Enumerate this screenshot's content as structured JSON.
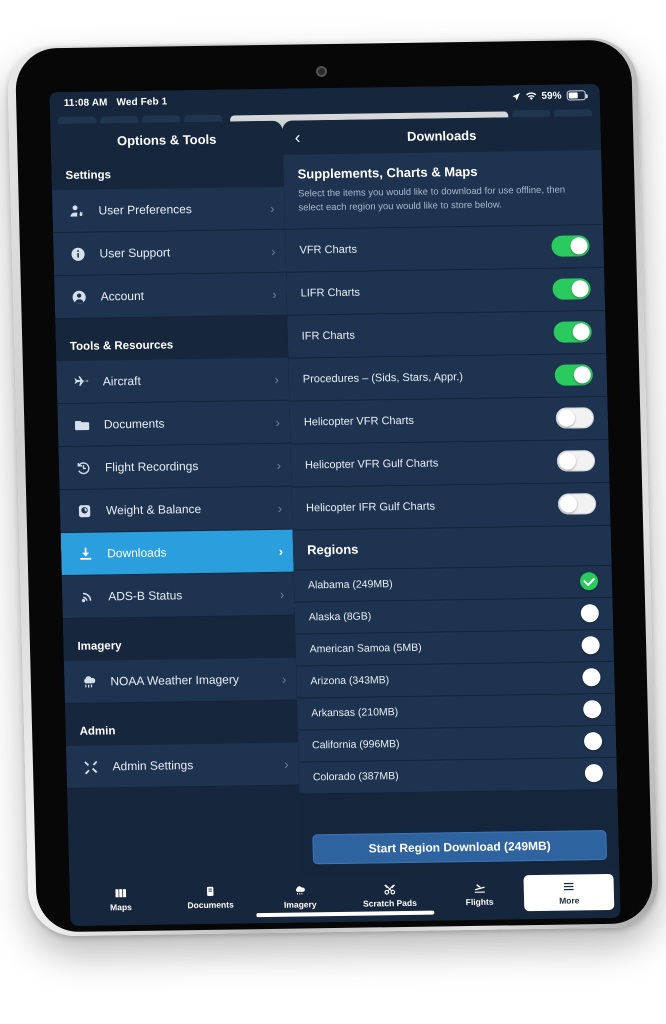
{
  "status_bar": {
    "time": "11:08 AM",
    "date": "Wed Feb 1",
    "battery_percent": "59%",
    "location_icon": "location-arrow-icon",
    "wifi_icon": "wifi-icon",
    "battery_icon": "battery-icon"
  },
  "sidebar": {
    "title": "Options & Tools",
    "groups": [
      {
        "header": "Settings",
        "items": [
          {
            "label": "User Preferences",
            "icon": "user-gear-icon",
            "active": false
          },
          {
            "label": "User Support",
            "icon": "info-circle-icon",
            "active": false
          },
          {
            "label": "Account",
            "icon": "person-circle-icon",
            "active": false
          }
        ]
      },
      {
        "header": "Tools & Resources",
        "items": [
          {
            "label": "Aircraft",
            "icon": "airplane-icon",
            "active": false
          },
          {
            "label": "Documents",
            "icon": "folder-icon",
            "active": false
          },
          {
            "label": "Flight Recordings",
            "icon": "clock-rewind-icon",
            "active": false
          },
          {
            "label": "Weight & Balance",
            "icon": "scale-icon",
            "active": false
          },
          {
            "label": "Downloads",
            "icon": "download-icon",
            "active": true
          },
          {
            "label": "ADS-B Status",
            "icon": "broadcast-icon",
            "active": false
          }
        ]
      },
      {
        "header": "Imagery",
        "items": [
          {
            "label": "NOAA Weather Imagery",
            "icon": "cloud-rain-icon",
            "active": false
          }
        ]
      },
      {
        "header": "Admin",
        "items": [
          {
            "label": "Admin Settings",
            "icon": "tools-icon",
            "active": false
          }
        ]
      }
    ]
  },
  "detail": {
    "title": "Downloads",
    "back_icon": "chevron-left-icon",
    "section": {
      "title": "Supplements, Charts & Maps",
      "description": "Select the items you would like to download for use offline, then select each region you would like to store below."
    },
    "chart_toggles": [
      {
        "label": "VFR Charts",
        "on": true
      },
      {
        "label": "LIFR Charts",
        "on": true
      },
      {
        "label": "IFR Charts",
        "on": true
      },
      {
        "label": "Procedures – (Sids, Stars, Appr.)",
        "on": true
      },
      {
        "label": "Helicopter VFR Charts",
        "on": false
      },
      {
        "label": "Helicopter VFR Gulf Charts",
        "on": false
      },
      {
        "label": "Helicopter IFR Gulf Charts",
        "on": false
      }
    ],
    "regions_header": "Regions",
    "regions": [
      {
        "label": "Alabama (249MB)",
        "selected": true
      },
      {
        "label": "Alaska (8GB)",
        "selected": false
      },
      {
        "label": "American Samoa (5MB)",
        "selected": false
      },
      {
        "label": "Arizona (343MB)",
        "selected": false
      },
      {
        "label": "Arkansas (210MB)",
        "selected": false
      },
      {
        "label": "California (996MB)",
        "selected": false
      },
      {
        "label": "Colorado (387MB)",
        "selected": false
      }
    ],
    "download_button": "Start Region Download (249MB)"
  },
  "tabbar": {
    "tabs": [
      {
        "label": "Maps",
        "icon": "map-icon",
        "active": false
      },
      {
        "label": "Documents",
        "icon": "document-icon",
        "active": false
      },
      {
        "label": "Imagery",
        "icon": "cloud-icon",
        "active": false
      },
      {
        "label": "Scratch Pads",
        "icon": "scissors-icon",
        "active": false
      },
      {
        "label": "Flights",
        "icon": "plane-depart-icon",
        "active": false
      },
      {
        "label": "More",
        "icon": "hamburger-icon",
        "active": true
      }
    ]
  },
  "colors": {
    "accent_blue": "#2b9ede",
    "toggle_on_green": "#2bca5e",
    "panel_navy": "#16273d",
    "row_navy": "#1d3350",
    "button_blue": "#2f639f"
  }
}
